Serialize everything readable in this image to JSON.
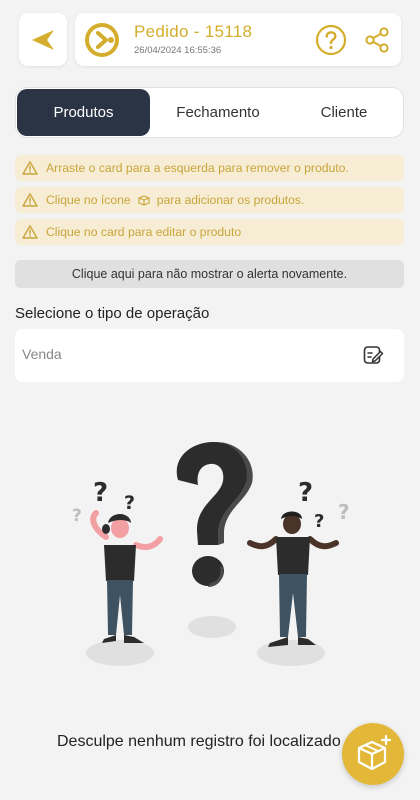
{
  "header": {
    "title": "Pedido - 15118",
    "datetime": "26/04/2024 16:55:36"
  },
  "tabs": [
    "Produtos",
    "Fechamento",
    "Cliente"
  ],
  "alerts": {
    "remove": "Arraste o card para a esquerda para remover o produto.",
    "add_prefix": "Clique no ícone",
    "add_suffix": "para adicionar os produtos.",
    "edit": "Clique no card para editar o produto"
  },
  "dismiss_label": "Clique aqui para não mostrar o alerta novamente.",
  "operation": {
    "label": "Selecione o tipo de operação",
    "value": "Venda"
  },
  "empty_message": "Desculpe nenhum registro foi localizado",
  "colors": {
    "accent": "#d4ad2c",
    "tab_active": "#2b3445",
    "alert_bg": "#f6edd4",
    "fab": "#e3b838"
  }
}
